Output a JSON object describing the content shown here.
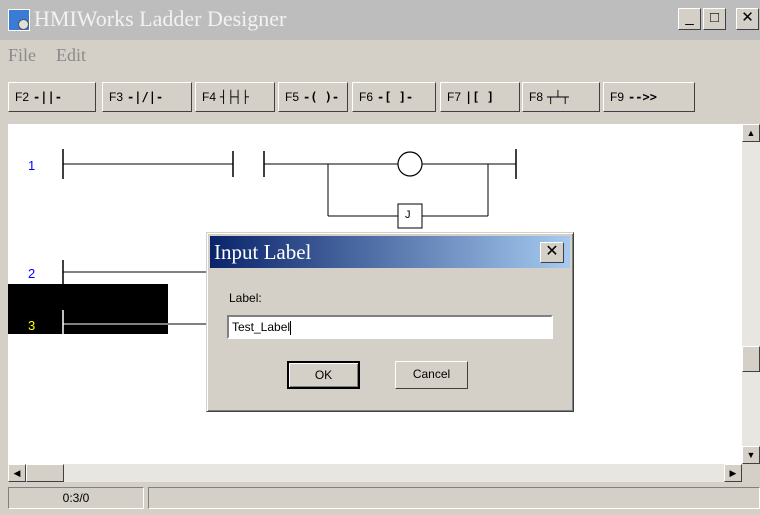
{
  "window": {
    "title": "HMIWorks Ladder Designer",
    "min_glyph": "_",
    "max_glyph": "□",
    "close_glyph": "✕"
  },
  "menu": {
    "items": [
      "File",
      "Edit"
    ]
  },
  "toolbar": {
    "buttons": [
      {
        "key": "F2",
        "icon": "-||-"
      },
      {
        "key": "F3",
        "icon": "-|/|-"
      },
      {
        "key": "F4",
        "icon": "┤├┤├"
      },
      {
        "key": "F5",
        "icon": "-( )-"
      },
      {
        "key": "F6",
        "icon": "-[ ]-"
      },
      {
        "key": "F7",
        "icon": "|[ ]"
      },
      {
        "key": "F8",
        "icon": "┬┴┬"
      },
      {
        "key": "F9",
        "icon": "-->>"
      }
    ]
  },
  "ladder": {
    "rungs": [
      "1",
      "2",
      "3"
    ],
    "jump_label": "J"
  },
  "status": {
    "position": "0:3/0",
    "message": ""
  },
  "dialog": {
    "title": "Input Label",
    "field_label": "Label:",
    "field_value": "Test_Label",
    "ok_label": "OK",
    "cancel_label": "Cancel"
  },
  "colors": {
    "rung_number": "#0000ff",
    "selected_rung_bg": "#000000",
    "selected_rung_text": "#ffff00",
    "dialog_title_start": "#0a246a",
    "dialog_title_end": "#a6caf0"
  }
}
